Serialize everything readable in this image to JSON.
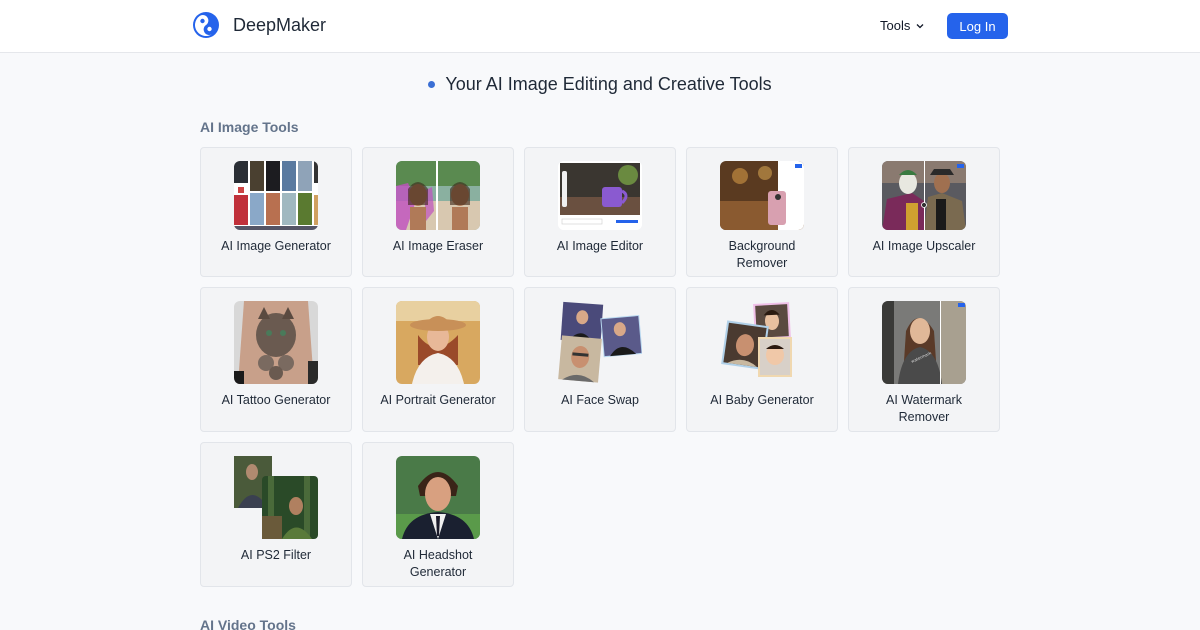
{
  "header": {
    "brand": "DeepMaker",
    "tools_label": "Tools",
    "login_label": "Log In",
    "accent_color": "#2563eb"
  },
  "hero": {
    "title": "Your AI Image Editing and Creative Tools"
  },
  "sections": [
    {
      "title": "AI Image Tools",
      "tools": [
        {
          "label": "AI Image Generator"
        },
        {
          "label": "AI Image Eraser"
        },
        {
          "label": "AI Image Editor"
        },
        {
          "label": "Background Remover"
        },
        {
          "label": "AI Image Upscaler"
        },
        {
          "label": "AI Tattoo Generator"
        },
        {
          "label": "AI Portrait Generator"
        },
        {
          "label": "AI Face Swap"
        },
        {
          "label": "AI Baby Generator"
        },
        {
          "label": "AI Watermark Remover"
        },
        {
          "label": "AI PS2 Filter"
        },
        {
          "label": "AI Headshot Generator"
        }
      ]
    },
    {
      "title": "AI Video Tools"
    }
  ]
}
